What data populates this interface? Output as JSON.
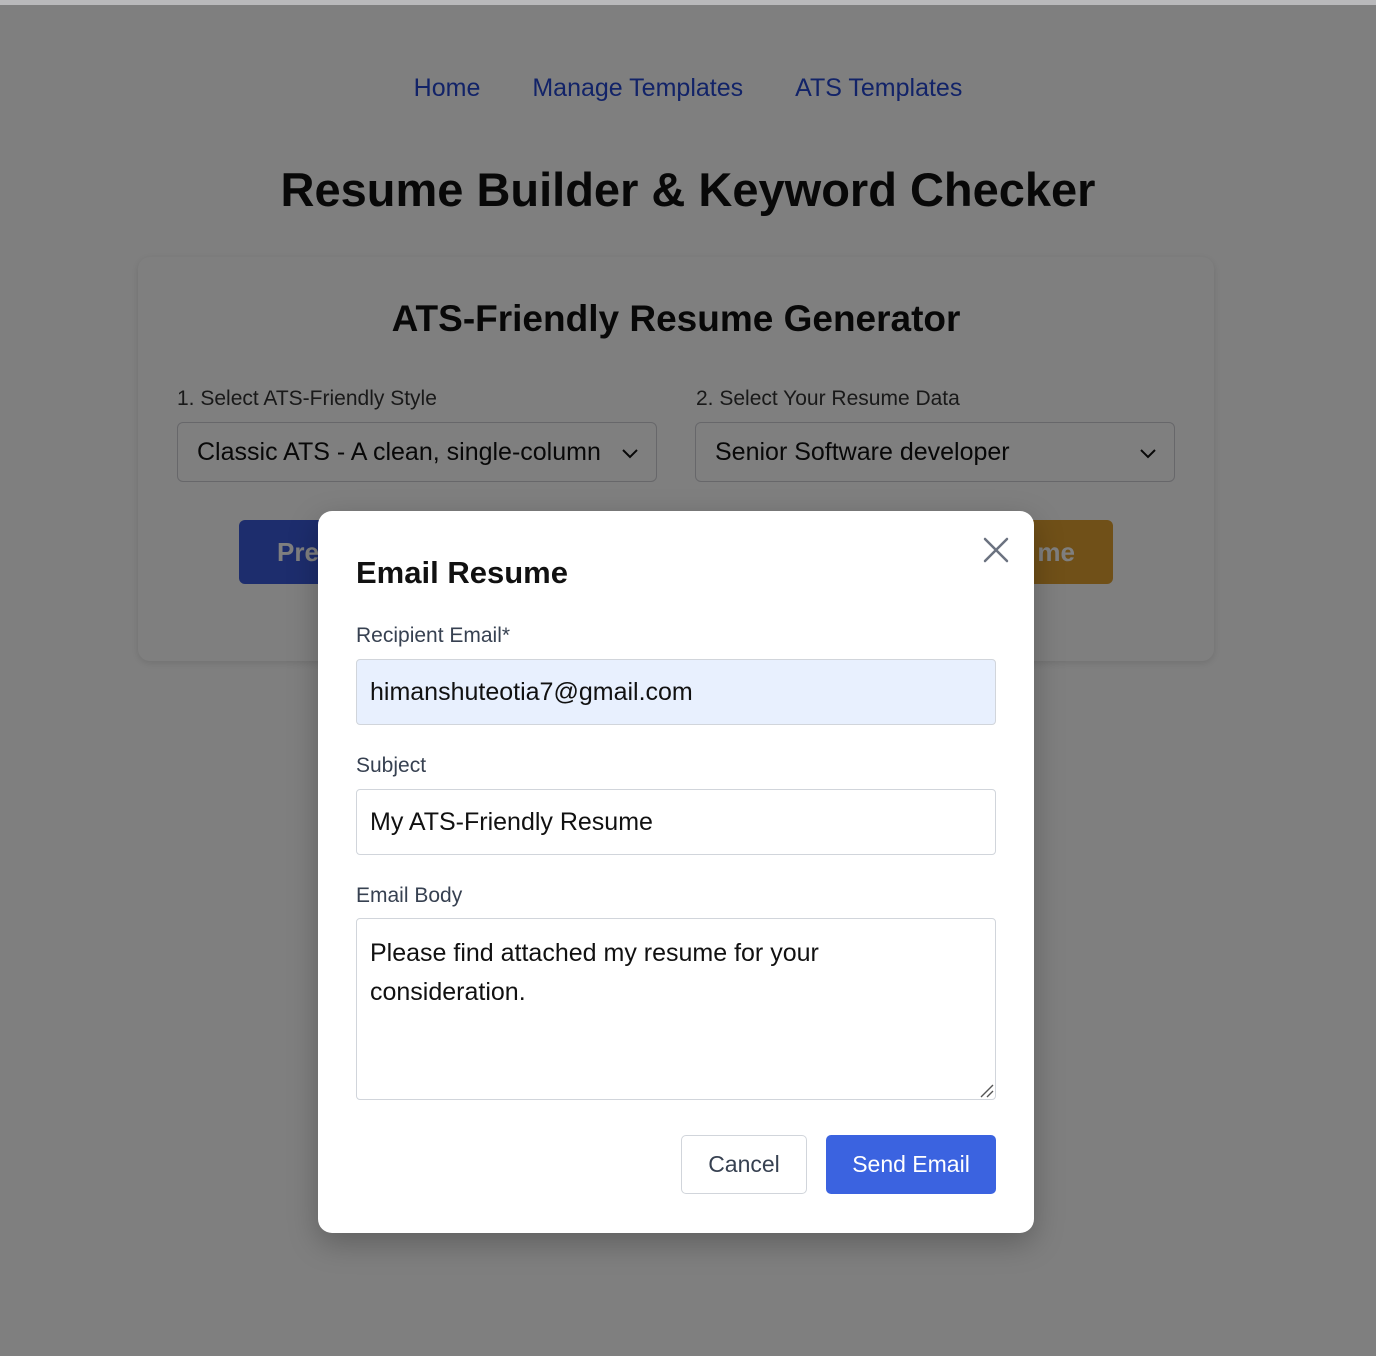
{
  "nav": {
    "items": [
      "Home",
      "Manage Templates",
      "ATS Templates"
    ]
  },
  "page": {
    "title": "Resume Builder & Keyword Checker"
  },
  "generator": {
    "title": "ATS-Friendly Resume Generator",
    "style_label": "1. Select ATS-Friendly Style",
    "style_value": "Classic ATS - A clean, single-column",
    "data_label": "2. Select Your Resume Data",
    "data_value": "Senior Software developer",
    "preview_button_visible": "Pre",
    "download_button_visible": "me"
  },
  "modal": {
    "title": "Email Resume",
    "recipient_label": "Recipient Email*",
    "recipient_value": "himanshuteotia7@gmail.com",
    "subject_label": "Subject",
    "subject_value": "My ATS-Friendly Resume",
    "body_label": "Email Body",
    "body_value": "Please find attached my resume for your\nconsideration.",
    "cancel_label": "Cancel",
    "send_label": "Send Email"
  },
  "colors": {
    "link": "#2547d0",
    "primary": "#3b63e0",
    "autofill": "#e8f0fe",
    "accent_orange": "#e0a030"
  }
}
